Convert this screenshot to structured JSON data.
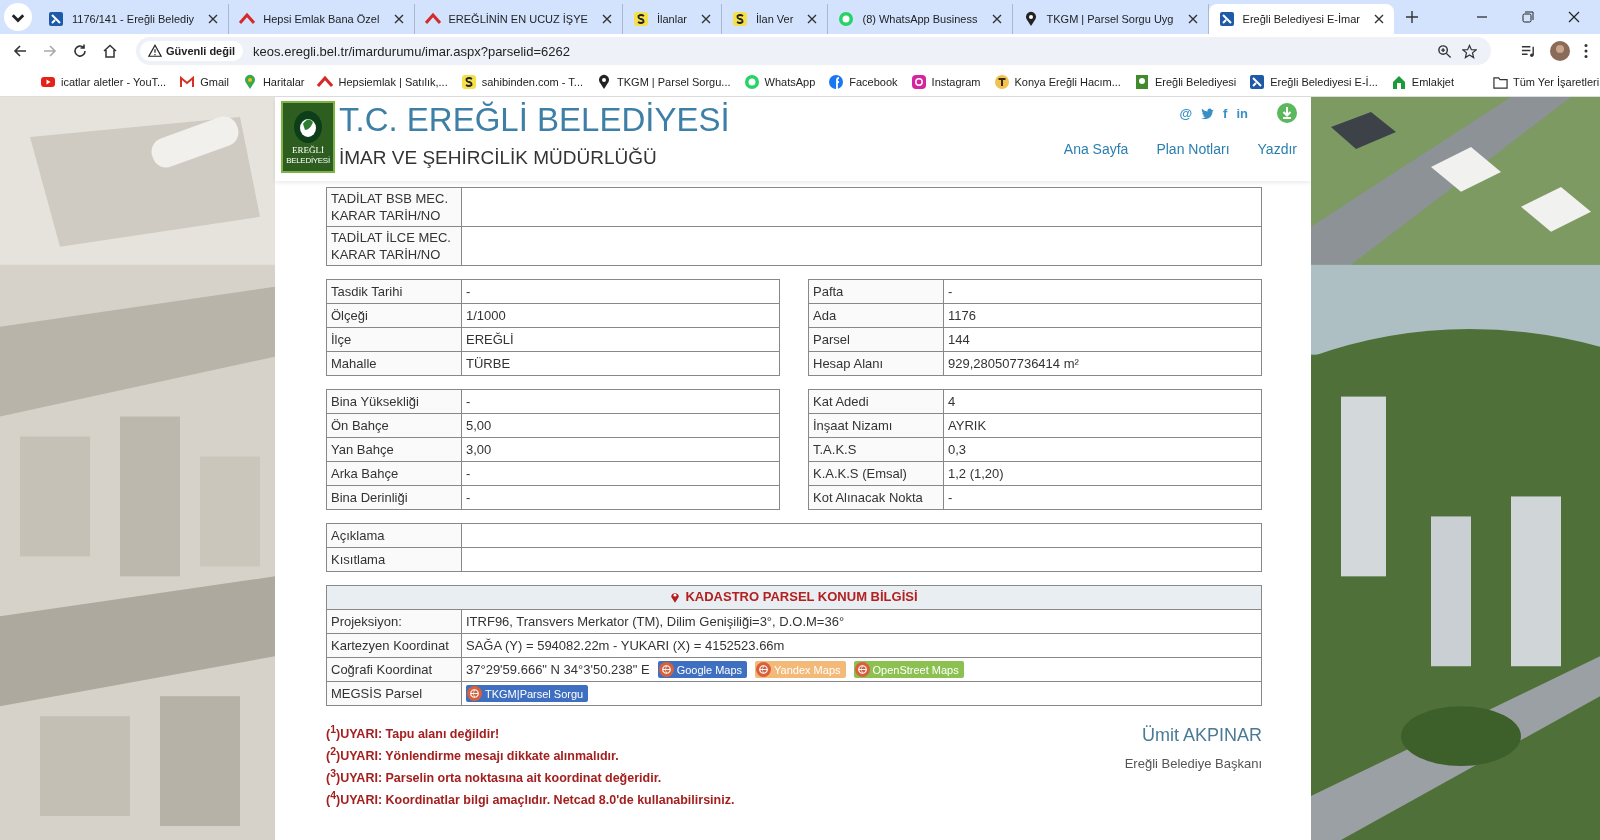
{
  "browser": {
    "tabs": [
      {
        "title": "1176/141 - Ereğli Belediy",
        "kind": "eimar",
        "selected": false
      },
      {
        "title": "Hepsi Emlak Bana Özel",
        "kind": "hepsi",
        "selected": false
      },
      {
        "title": "EREĞLİNİN EN UCUZ İŞYE",
        "kind": "hepsi",
        "selected": false
      },
      {
        "title": "İlanlar",
        "kind": "sahibinden",
        "selected": false
      },
      {
        "title": "İlan Ver",
        "kind": "sahibinden",
        "selected": false
      },
      {
        "title": "(8) WhatsApp Business",
        "kind": "whatsapp",
        "selected": false
      },
      {
        "title": "TKGM | Parsel Sorgu Uyg",
        "kind": "pin",
        "selected": false
      },
      {
        "title": "Ereğli Belediyesi E-İmar",
        "kind": "eimar",
        "selected": true
      }
    ],
    "security": "Güvenli değil",
    "url": "keos.eregli.bel.tr/imardurumu/imar.aspx?parselid=6262",
    "bookmarks": [
      {
        "label": "icatlar aletler - YouT...",
        "kind": "youtube"
      },
      {
        "label": "Gmail",
        "kind": "gmail"
      },
      {
        "label": "Haritalar",
        "kind": "maps"
      },
      {
        "label": "Hepsiemlak | Satılık,...",
        "kind": "hepsi"
      },
      {
        "label": "sahibinden.com - T...",
        "kind": "sahibinden"
      },
      {
        "label": "TKGM | Parsel Sorgu...",
        "kind": "pin"
      },
      {
        "label": "WhatsApp",
        "kind": "whatsapp"
      },
      {
        "label": "Facebook",
        "kind": "facebook"
      },
      {
        "label": "Instagram",
        "kind": "instagram"
      },
      {
        "label": "Konya Ereğli Hacım...",
        "kind": "konya"
      },
      {
        "label": "Ereğli Belediyesi",
        "kind": "belediye"
      },
      {
        "label": "Ereğli Belediyesi E-İ...",
        "kind": "eimar"
      },
      {
        "label": "Emlakjet",
        "kind": "emlakjet"
      }
    ],
    "all_bookmarks": "Tüm Yer İşaretleri"
  },
  "header": {
    "logo_text": "EREĞLİ",
    "logo_subtext": "BELEDİYESİ",
    "title": "T.C. EREĞLİ BELEDİYESİ",
    "subtitle": "İMAR VE ŞEHİRCİLİK MÜDÜRLÜĞÜ",
    "social": [
      {
        "kind": "text",
        "label": "@"
      },
      {
        "kind": "twitter"
      },
      {
        "kind": "text",
        "label": "f"
      },
      {
        "kind": "text",
        "label": "in"
      }
    ],
    "nav": [
      "Ana Sayfa",
      "Plan Notları",
      "Yazdır"
    ]
  },
  "amendments": [
    {
      "label": "TADİLAT BSB MEC. KARAR TARİH/NO"
    },
    {
      "label": "TADİLAT İLCE MEC. KARAR TARİH/NO"
    }
  ],
  "plan_left": [
    {
      "label": "Tasdik Tarihi",
      "value": "-"
    },
    {
      "label": "Ölçeği",
      "value": "1/1000"
    },
    {
      "label": "İlçe",
      "value": "EREĞLİ"
    },
    {
      "label": "Mahalle",
      "value": "TÜRBE"
    }
  ],
  "plan_right": [
    {
      "label": "Pafta",
      "value": "-"
    },
    {
      "label": "Ada",
      "value": "1176"
    },
    {
      "label": "Parsel",
      "value": "144"
    },
    {
      "label": "Hesap Alanı",
      "value": "929,280507736414 m²"
    }
  ],
  "building_left": [
    {
      "label": "Bina Yüksekliği",
      "value": "-"
    },
    {
      "label": "Ön Bahçe",
      "value": "5,00"
    },
    {
      "label": "Yan Bahçe",
      "value": "3,00"
    },
    {
      "label": "Arka Bahçe",
      "value": "-"
    },
    {
      "label": "Bina Derinliği",
      "value": "-"
    }
  ],
  "building_right": [
    {
      "label": "Kat Adedi",
      "value": "4"
    },
    {
      "label": "İnşaat Nizamı",
      "value": "AYRIK"
    },
    {
      "label": "T.A.K.S",
      "value": "0,3"
    },
    {
      "label": "K.A.K.S (Emsal)",
      "value": "1,2 (1,20)"
    },
    {
      "label": "Kot Alınacak Nokta",
      "value": "-"
    }
  ],
  "remarks": [
    {
      "label": "Açıklama"
    },
    {
      "label": "Kısıtlama"
    }
  ],
  "location": {
    "title": "KADASTRO PARSEL KONUM BİLGİSİ",
    "rows": [
      {
        "label": "Projeksiyon:",
        "value": "ITRF96, Transvers Merkator (TM), Dilim Genişiliği=3°, D.O.M=36°"
      },
      {
        "label": "Kartezyen Koordinat",
        "value": "SAĞA (Y) = 594082.22m - YUKARI (X) = 4152523.66m"
      },
      {
        "label": "Coğrafi Koordinat",
        "value": "37°29'59.666\" N 34°3'50.238\" E",
        "links": [
          {
            "label": "Google Maps",
            "color": "#3f6fc0"
          },
          {
            "label": "Yandex Maps",
            "color": "#f3b978"
          },
          {
            "label": "OpenStreet Maps",
            "color": "#8cc152"
          }
        ]
      },
      {
        "label": "MEGSİS Parsel",
        "links": [
          {
            "label": "TKGM|Parsel Sorgu",
            "color": "#3f6fc0"
          }
        ]
      }
    ]
  },
  "warnings": [
    "($^{1}$)UYARI: Tapu alanı değildir!",
    "($^{2}$)UYARI: Yönlendirme mesajı dikkate alınmalıdır.",
    "($^{3}$)UYARI: Parselin orta noktasına ait koordinat değeridir.",
    "($^{4}$)UYARI: Koordinatlar bilgi amaçlıdır. Netcad 8.0'de kullanabilirsiniz."
  ],
  "signature": {
    "name": "Ümit AKPINAR",
    "title": "Ereğli Belediye Başkanı"
  }
}
